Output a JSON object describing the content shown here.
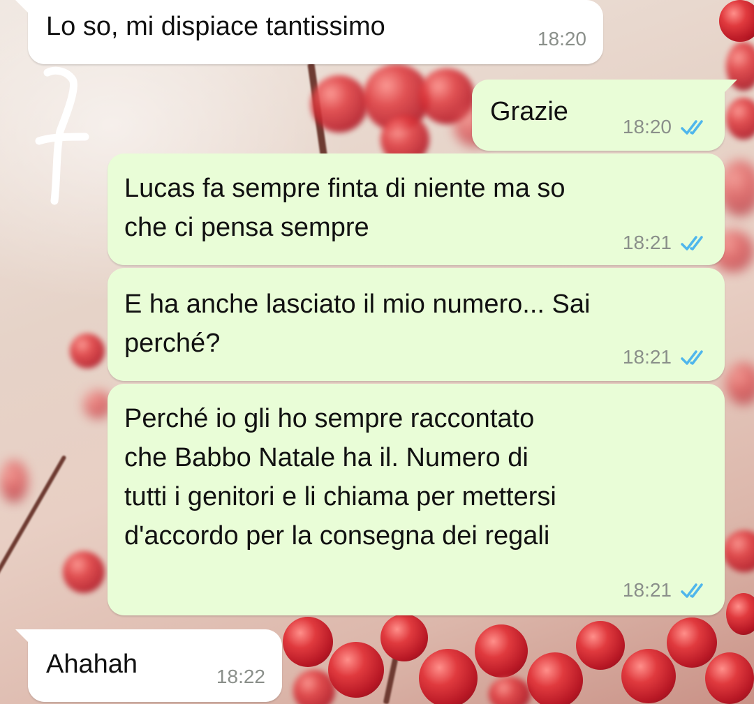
{
  "messages": [
    {
      "direction": "incoming",
      "text": "Lo so, mi dispiace tantissimo",
      "time": "18:20"
    },
    {
      "direction": "outgoing",
      "text": "Grazie",
      "time": "18:20",
      "status": "read"
    },
    {
      "direction": "outgoing",
      "text": "Lucas fa sempre finta di niente ma so\nche ci pensa sempre",
      "time": "18:21",
      "status": "read"
    },
    {
      "direction": "outgoing",
      "text": "E ha anche lasciato il mio numero... Sai\nperché?",
      "time": "18:21",
      "status": "read"
    },
    {
      "direction": "outgoing",
      "text": "Perché io gli ho sempre raccontato\nche Babbo Natale ha il. Numero di\ntutti i genitori e li chiama per mettersi\nd'accordo per la consegna dei regali",
      "time": "18:21",
      "status": "read"
    },
    {
      "direction": "incoming",
      "text": "Ahahah",
      "time": "18:22"
    }
  ],
  "icons": {
    "read_receipt": "double-check-icon",
    "doodle": "handwritten-doodle"
  },
  "colors": {
    "incoming_bubble": "#ffffff",
    "outgoing_bubble": "#e9fdd7",
    "timestamp": "#8a8f8a",
    "read_ticks": "#4fb6ec",
    "wallpaper_berries": "#c8202e"
  }
}
